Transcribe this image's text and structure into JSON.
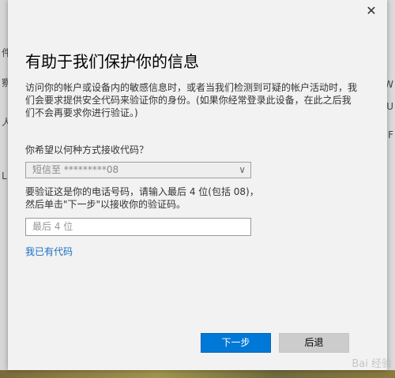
{
  "background": {
    "left_fragments": [
      "件",
      "察",
      "人",
      "L"
    ],
    "right_fragments": [
      "W",
      "U",
      "F"
    ]
  },
  "dialog": {
    "close_glyph": "✕",
    "title": "有助于我们保护你的信息",
    "description": "访问你的帐户或设备内的敏感信息时，或者当我们检测到可疑的帐户活动时，我们会要求提供安全代码来验证你的身份。(如果你经常登录此设备，在此之后我们不会再要求你进行验证。)",
    "question": "你希望以何种方式接收代码？",
    "method_select": {
      "value": "短信至 *********08"
    },
    "instruction": "要验证这是你的电话号码，请输入最后 4 位(包括 08)，然后单击\"下一步\"以接收你的验证码。",
    "digits_input": {
      "placeholder": "最后 4 位",
      "value": ""
    },
    "have_code_link": "我已有代码",
    "next_button": "下一步",
    "back_button": "后退"
  },
  "watermark": "Bai 经验",
  "colors": {
    "primary": "#0078d7",
    "link": "#1a6fc2"
  }
}
